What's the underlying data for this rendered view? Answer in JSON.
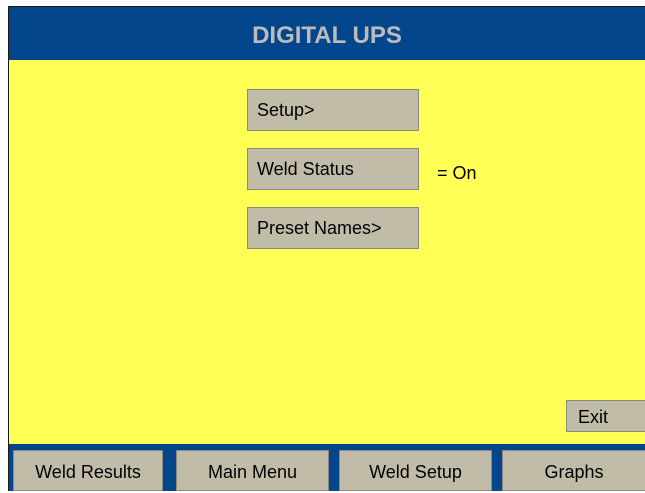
{
  "header": {
    "title": "DIGITAL UPS"
  },
  "main": {
    "setup_label": "Setup>",
    "weld_status_label": "Weld Status",
    "weld_status_value": "= On",
    "preset_names_label": "Preset Names>",
    "exit_label": "Exit"
  },
  "bottom_nav": {
    "weld_results": "Weld Results",
    "main_menu": "Main Menu",
    "weld_setup": "Weld Setup",
    "graphs": "Graphs"
  },
  "colors": {
    "title_bar": "#04468c",
    "title_text": "#bcbcbc",
    "background": "#ffff55",
    "button": "#c0bca8"
  }
}
